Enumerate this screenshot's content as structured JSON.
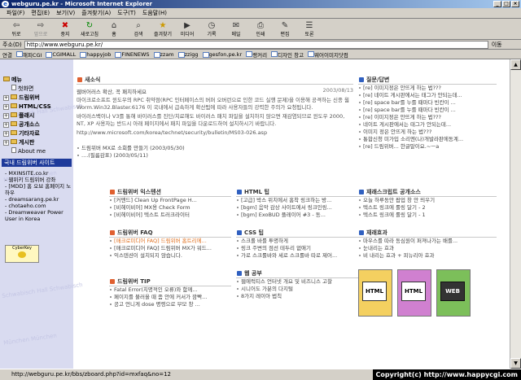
{
  "window": {
    "title": "webguru.pe.kr - Microsoft Internet Explorer"
  },
  "menu": [
    "파일(F)",
    "편집(E)",
    "보기(V)",
    "즐겨찾기(A)",
    "도구(T)",
    "도움말(H)"
  ],
  "toolbar": [
    {
      "label": "뒤로",
      "icon": "back-icon"
    },
    {
      "label": "앞으로",
      "icon": "forward-icon"
    },
    {
      "label": "중지",
      "icon": "stop-icon"
    },
    {
      "label": "새로고침",
      "icon": "refresh-icon"
    },
    {
      "label": "홈",
      "icon": "home-icon"
    },
    {
      "label": "검색",
      "icon": "search-icon"
    },
    {
      "label": "즐겨찾기",
      "icon": "favorites-icon"
    },
    {
      "label": "미디어",
      "icon": "media-icon"
    },
    {
      "label": "기록",
      "icon": "history-icon"
    },
    {
      "label": "메일",
      "icon": "mail-icon"
    },
    {
      "label": "인쇄",
      "icon": "print-icon"
    },
    {
      "label": "편집",
      "icon": "edit-icon"
    },
    {
      "label": "토론",
      "icon": "discuss-icon"
    }
  ],
  "address": {
    "label": "주소(D)",
    "url": "http://www.webguru.pe.kr/",
    "go": "이동"
  },
  "links": {
    "label": "연결",
    "items": [
      "해피CGI",
      "CGIMALL",
      "happyjob",
      "FINENEWS",
      "zzam",
      "zzigg",
      "gesfon,pe.kr",
      "랭커리",
      "디자인 창고",
      "웨어이미지닷컴"
    ]
  },
  "sidebar": {
    "tree": [
      {
        "label": "메뉴",
        "type": "root"
      },
      {
        "label": "첫화면",
        "type": "page"
      },
      {
        "label": "드림위버",
        "type": "folder"
      },
      {
        "label": "HTML/CSS",
        "type": "folder"
      },
      {
        "label": "플래시",
        "type": "folder"
      },
      {
        "label": "공개소스",
        "type": "folder"
      },
      {
        "label": "기타자료",
        "type": "folder"
      },
      {
        "label": "게시판",
        "type": "folder"
      },
      {
        "label": "About me",
        "type": "page"
      }
    ],
    "site_title": "국내 드림위버 사이트",
    "sites": [
      "- MXINSITE.co.kr",
      "- 웹위키 드림위버 강좌",
      "- [MDD] 홈 오브 홈페이지 노하우",
      "- dreamsarang.pe.kr",
      "- chotaeho.com",
      "- Dreamweaver Power User in Korea"
    ],
    "badge": "CyberKey",
    "watermark": [
      "Schwabisch Hall Schwabisch",
      "München München",
      "Schwabisch Hall Schwabisch",
      "München München"
    ]
  },
  "news": {
    "title": "새소식",
    "headline": "웹버어러스 확산, 꼭 패치하세요",
    "date": "2003/08/13",
    "body": "마이크로소프트 윈도우의 RPC 취약점(RPC 인터페이스의 버퍼 오버런으로 인한 코드 실행 문제)을 이용해 공격하는 신종 웜 Worm.Win32.Blaster.6176 이 국내에서 급속하게 확산됨에 따라 사용자들의 강력한 주의가 요청됩니다.",
    "body2": "바이러스백이나 V3를 통해 바이러스를 진단/치료해도 바이러스 패치 파일을 설치하지 않으면 재감염되므로 윈도우 2000, NT, XP 사용자는 반드시 아래 페이지에서 패치 파일을 다운로드하여 설치하시기 바랍니다.",
    "link": "http://www.microsoft.com/korea/technet/security/bulletin/MS03-026.asp",
    "more": [
      {
        "text": "드림위버 MX로 소회를 만들기",
        "date": "(2003/05/30)"
      },
      {
        "text": "....(필름감표)",
        "date": "(2003/05/11)"
      }
    ]
  },
  "qna": {
    "title": "질문/답변",
    "items": [
      "[re] 이미지정은 안뜨게 하는 법???",
      "[re] 네이트 게시판에서는 태그가 안되는데...",
      "[re] space bar를 누를 때마다 빈칸이 ...",
      "[re] space bar를 누를 때마다 빈칸이 ...",
      "[re] 이미지정은 안뜨게 하는 법???",
      "네이트 게시판에서는 태그가 안되는데...",
      "이미지 정은 안뜨게 하는 법???",
      "통합신청 미가입 소리엔(나)개발라판에동계...",
      "[re] 드림위버... 한글말이요.~ㅡa"
    ]
  },
  "dw_ext": {
    "title": "드림위버 익스텐션",
    "items": [
      "[커맨드] Clean Up FrontPage H...",
      "[비헤이비어] MX용 Check Form",
      "[비헤이비어] 텍스트 트러크라이터"
    ]
  },
  "html_tip": {
    "title": "HTML 팁",
    "items": [
      "[고급] 박스 위치에서 홈착 링크하는 방...",
      "[bgm] 음악 감상 사이트에서 링크인링...",
      "[bgm] ExoBUD 플레이어 #3 - 동..."
    ]
  },
  "open_src": {
    "title": "재래스크립트 공개소스",
    "items": [
      "오늘 하루동안 팝업 창 안 띄우기",
      "텍스트 링크에 롤링 달기 - 2",
      "텍스트 링크에 롤링 달기 - 1"
    ]
  },
  "dw_faq": {
    "title": "드림위버 FAQ",
    "items": [
      "[매크로미디어 FAQ] 드림위버 홈트리에...",
      "[매크로미디어 FAQ] 드림위버 MX가 워드...",
      "익스텐션이 설치되지 않습니다."
    ]
  },
  "css_tip": {
    "title": "CSS 팁",
    "items": [
      "스크롤 바를 투명하게",
      "링크 주변의 점선 테두리 없애기",
      "가로 스크롤바와 세로 스크롤바 따로 제어..."
    ]
  },
  "js_effect": {
    "title": "재래효과",
    "items": [
      "마우스를 따라 동심원이 퍼져나가는 배를...",
      "눈내리는 효과",
      "비 내리는 효과 + 피뉴리아 효과"
    ]
  },
  "dw_tip": {
    "title": "드림위버 TIP",
    "items": [
      "Fatal Error(치명적인 오류)와 함께...",
      "페이지를 불러올 때 좀 안에 커서가 깜빡...",
      "공고 언니게 dose 명령으로 부모 창 ..."
    ]
  },
  "web_study": {
    "title": "웹 공부",
    "items": [
      "웹에럭티스 언터넷 개요 및 비즈니스 고찰",
      "시니어도 가분의 다지털",
      "8가지 레이아 법칙"
    ]
  },
  "books": [
    {
      "label": "HTML",
      "color": "#e8a020"
    },
    {
      "label": "HTML",
      "color": "#b050b0"
    },
    {
      "label": "WEB",
      "color": "#40a040"
    }
  ],
  "status": {
    "url": "http://webguru.pe.kr/bbs/zboard.php?id=mxfaq&no=12",
    "copyright": "Copyright(c) http://www.happycgi.com"
  }
}
